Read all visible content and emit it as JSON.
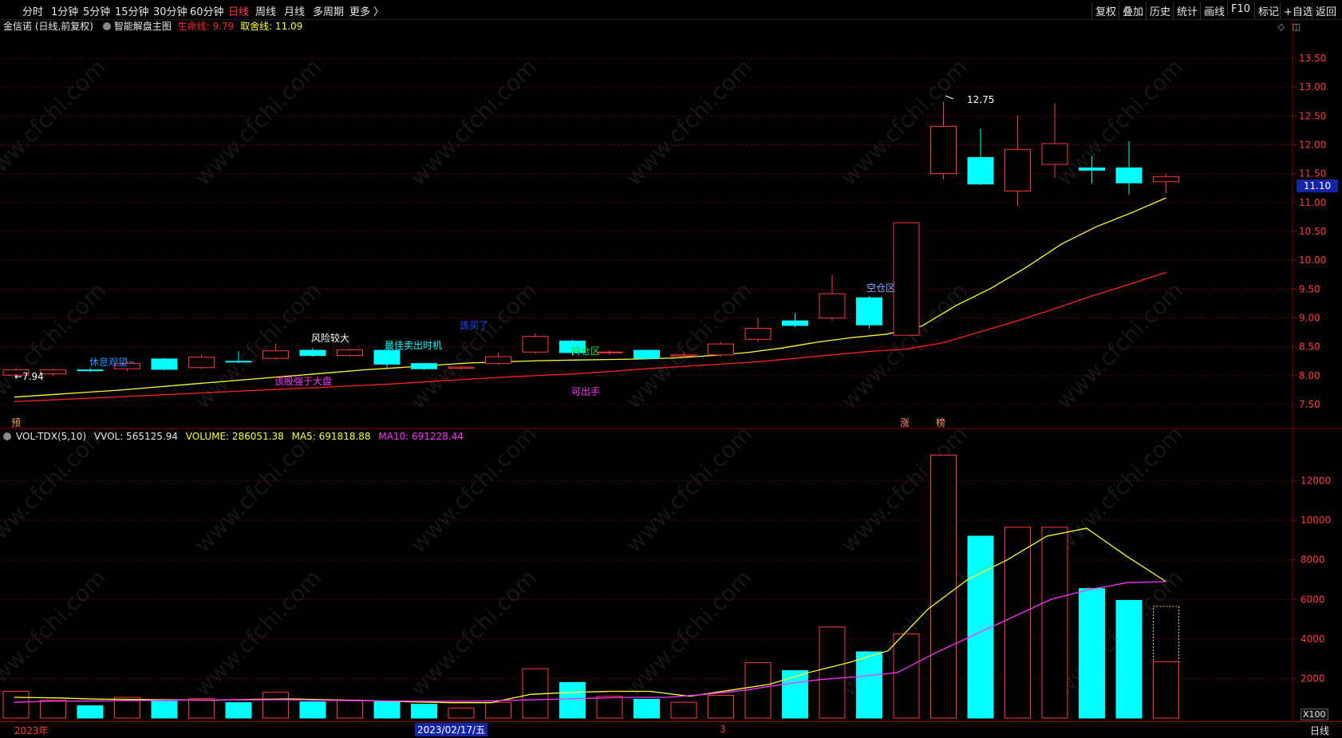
{
  "toolbar": {
    "periods": [
      {
        "label": "分时"
      },
      {
        "label": "1分钟"
      },
      {
        "label": "5分钟"
      },
      {
        "label": "15分钟"
      },
      {
        "label": "30分钟"
      },
      {
        "label": "60分钟"
      },
      {
        "label": "日线",
        "active": true
      },
      {
        "label": "周线"
      },
      {
        "label": "月线"
      },
      {
        "label": "多周期"
      },
      {
        "label": "更多 〉"
      }
    ],
    "tools": [
      "复权",
      "叠加",
      "历史",
      "统计",
      "画线",
      "F10",
      "标记",
      "+自选",
      "返回"
    ]
  },
  "main_info": {
    "stock": "金信诺 (日线,前复权)",
    "indicator": "智能解盘主图",
    "life_line_label": "生命线: 9.79",
    "take_line_label": "取舍线: 11.09",
    "life_color": "#ff2222",
    "take_color": "#ffff33"
  },
  "vol_info": {
    "name": "VOL-TDX(5,10)",
    "vvol": "VVOL: 565125.94",
    "volume": "VOLUME: 286051.38",
    "ma5": "MA5: 691818.88",
    "ma10": "MA10: 691228.44",
    "vol_color": "#ffff33",
    "ma10_color": "#ff33ff"
  },
  "current_price_tag": "11.10",
  "bottom": {
    "year_label": "2023年",
    "date_label": "2023/02/17/五",
    "month_label": "3",
    "multiplier": "X100",
    "period_button": "日线"
  },
  "watermark": "www.cfchi.com",
  "chart_data": {
    "type": "candlestick",
    "price_axis": {
      "ylim": [
        7.1,
        13.9
      ],
      "ticks": [
        "13.50",
        "13.00",
        "12.50",
        "12.00",
        "11.50",
        "11.00",
        "10.50",
        "10.00",
        "9.50",
        "9.00",
        "8.50",
        "8.00",
        "7.50"
      ]
    },
    "volume_axis": {
      "ylim": [
        0,
        13800
      ],
      "ticks": [
        "12000",
        "10000",
        "8000",
        "6000",
        "4000",
        "2000"
      ]
    },
    "candles": [
      {
        "o": 8.1,
        "c": 8.01,
        "h": 8.14,
        "l": 7.96,
        "vol": 1350,
        "up": true
      },
      {
        "o": 8.03,
        "c": 8.1,
        "h": 8.12,
        "l": 8.0,
        "vol": 900,
        "up": true
      },
      {
        "o": 8.1,
        "c": 8.1,
        "h": 8.14,
        "l": 8.06,
        "vol": 620,
        "up": false
      },
      {
        "o": 8.12,
        "c": 8.21,
        "h": 8.25,
        "l": 8.08,
        "vol": 1050,
        "up": true
      },
      {
        "o": 8.29,
        "c": 8.11,
        "h": 8.31,
        "l": 8.09,
        "vol": 850,
        "up": false
      },
      {
        "o": 8.14,
        "c": 8.32,
        "h": 8.36,
        "l": 8.12,
        "vol": 980,
        "up": true
      },
      {
        "o": 8.25,
        "c": 8.25,
        "h": 8.42,
        "l": 8.22,
        "vol": 780,
        "up": false
      },
      {
        "o": 8.3,
        "c": 8.43,
        "h": 8.55,
        "l": 8.28,
        "vol": 1300,
        "up": true
      },
      {
        "o": 8.44,
        "c": 8.35,
        "h": 8.48,
        "l": 8.33,
        "vol": 820,
        "up": false
      },
      {
        "o": 8.35,
        "c": 8.45,
        "h": 8.47,
        "l": 8.33,
        "vol": 900,
        "up": true
      },
      {
        "o": 8.44,
        "c": 8.2,
        "h": 8.46,
        "l": 8.12,
        "vol": 850,
        "up": false
      },
      {
        "o": 8.21,
        "c": 8.12,
        "h": 8.22,
        "l": 8.1,
        "vol": 700,
        "up": false
      },
      {
        "o": 8.13,
        "c": 8.15,
        "h": 8.17,
        "l": 8.1,
        "vol": 500,
        "up": true
      },
      {
        "o": 8.21,
        "c": 8.33,
        "h": 8.4,
        "l": 8.19,
        "vol": 800,
        "up": true
      },
      {
        "o": 8.41,
        "c": 8.68,
        "h": 8.74,
        "l": 8.38,
        "vol": 2500,
        "up": true
      },
      {
        "o": 8.6,
        "c": 8.4,
        "h": 8.62,
        "l": 8.35,
        "vol": 1800,
        "up": false
      },
      {
        "o": 8.4,
        "c": 8.41,
        "h": 8.45,
        "l": 8.36,
        "vol": 1100,
        "up": true
      },
      {
        "o": 8.44,
        "c": 8.3,
        "h": 8.45,
        "l": 8.28,
        "vol": 950,
        "up": false
      },
      {
        "o": 8.34,
        "c": 8.36,
        "h": 8.4,
        "l": 8.3,
        "vol": 800,
        "up": true
      },
      {
        "o": 8.36,
        "c": 8.55,
        "h": 8.58,
        "l": 8.33,
        "vol": 1150,
        "up": true
      },
      {
        "o": 8.63,
        "c": 8.82,
        "h": 9.0,
        "l": 8.58,
        "vol": 2800,
        "up": true
      },
      {
        "o": 8.95,
        "c": 8.87,
        "h": 9.08,
        "l": 8.84,
        "vol": 2400,
        "up": false
      },
      {
        "o": 9.0,
        "c": 9.42,
        "h": 9.74,
        "l": 8.95,
        "vol": 4600,
        "up": true
      },
      {
        "o": 9.35,
        "c": 8.88,
        "h": 9.38,
        "l": 8.82,
        "vol": 3350,
        "up": false
      },
      {
        "o": 8.7,
        "c": 10.65,
        "h": 10.66,
        "l": 8.7,
        "vol": 4250,
        "up": true
      },
      {
        "o": 11.5,
        "c": 12.32,
        "h": 12.75,
        "l": 11.4,
        "vol": 13300,
        "up": true
      },
      {
        "o": 11.78,
        "c": 11.32,
        "h": 12.28,
        "l": 11.3,
        "vol": 9200,
        "up": false
      },
      {
        "o": 11.2,
        "c": 11.92,
        "h": 12.51,
        "l": 10.94,
        "vol": 9650,
        "up": true
      },
      {
        "o": 11.66,
        "c": 12.02,
        "h": 12.72,
        "l": 11.43,
        "vol": 9650,
        "up": true
      },
      {
        "o": 11.6,
        "c": 11.56,
        "h": 11.8,
        "l": 11.33,
        "vol": 6550,
        "up": false
      },
      {
        "o": 11.6,
        "c": 11.34,
        "h": 12.06,
        "l": 11.14,
        "vol": 5950,
        "up": false
      },
      {
        "o": 11.36,
        "c": 11.45,
        "h": 11.5,
        "l": 11.16,
        "vol": 2850,
        "up": true,
        "projected_vol": 5650
      }
    ],
    "lines": {
      "take_line": [
        7.63,
        7.67,
        7.71,
        7.75,
        7.8,
        7.85,
        7.9,
        7.95,
        8.0,
        8.05,
        8.1,
        8.14,
        8.18,
        8.22,
        8.24,
        8.26,
        8.27,
        8.28,
        8.29,
        8.31,
        8.35,
        8.4,
        8.48,
        8.58,
        8.66,
        8.72,
        8.86,
        9.22,
        9.52,
        9.88,
        10.28,
        10.58,
        10.82,
        11.08
      ],
      "life_line": [
        7.55,
        7.58,
        7.61,
        7.64,
        7.67,
        7.7,
        7.73,
        7.76,
        7.79,
        7.82,
        7.85,
        7.89,
        7.93,
        7.97,
        8.0,
        8.03,
        8.07,
        8.12,
        8.16,
        8.2,
        8.24,
        8.3,
        8.36,
        8.42,
        8.46,
        8.57,
        8.76,
        8.95,
        9.16,
        9.38,
        9.58,
        9.79
      ],
      "vol_ma5": [
        1050,
        1020,
        960,
        940,
        920,
        900,
        950,
        970,
        920,
        880,
        820,
        780,
        780,
        1200,
        1300,
        1350,
        1350,
        1100,
        1400,
        1700,
        2300,
        2800,
        3400,
        5500,
        7000,
        8000,
        9200,
        9600,
        8200,
        6900
      ],
      "vol_ma10": [
        800,
        850,
        860,
        880,
        900,
        910,
        920,
        930,
        900,
        880,
        860,
        850,
        850,
        900,
        950,
        1000,
        1050,
        1050,
        1200,
        1400,
        1700,
        1950,
        2100,
        2300,
        3300,
        4200,
        5100,
        6000,
        6500,
        6850,
        6900
      ]
    },
    "annotations": [
      {
        "text": "←7.94",
        "color": "#ffffff"
      },
      {
        "text": "休息观望~",
        "color": "#1e90ff"
      },
      {
        "text": "风险较大",
        "color": "#ffffff"
      },
      {
        "text": "最佳卖出时机",
        "color": "#00ffff"
      },
      {
        "text": "该股强于大盘",
        "color": "#ff33ff"
      },
      {
        "text": "该买了",
        "color": "#1e4dff"
      },
      {
        "text": "持仓区",
        "color": "#22dd22"
      },
      {
        "text": "可出手",
        "color": "#ff33ff"
      },
      {
        "text": "空仓区",
        "color": "#7aa7ff"
      },
      {
        "text": "12.75",
        "color": "#ffffff"
      },
      {
        "text": "预",
        "color": "#ff9955"
      },
      {
        "text": "涨",
        "color": "#ff9955"
      },
      {
        "text": "榜",
        "color": "#ff9955"
      }
    ]
  }
}
